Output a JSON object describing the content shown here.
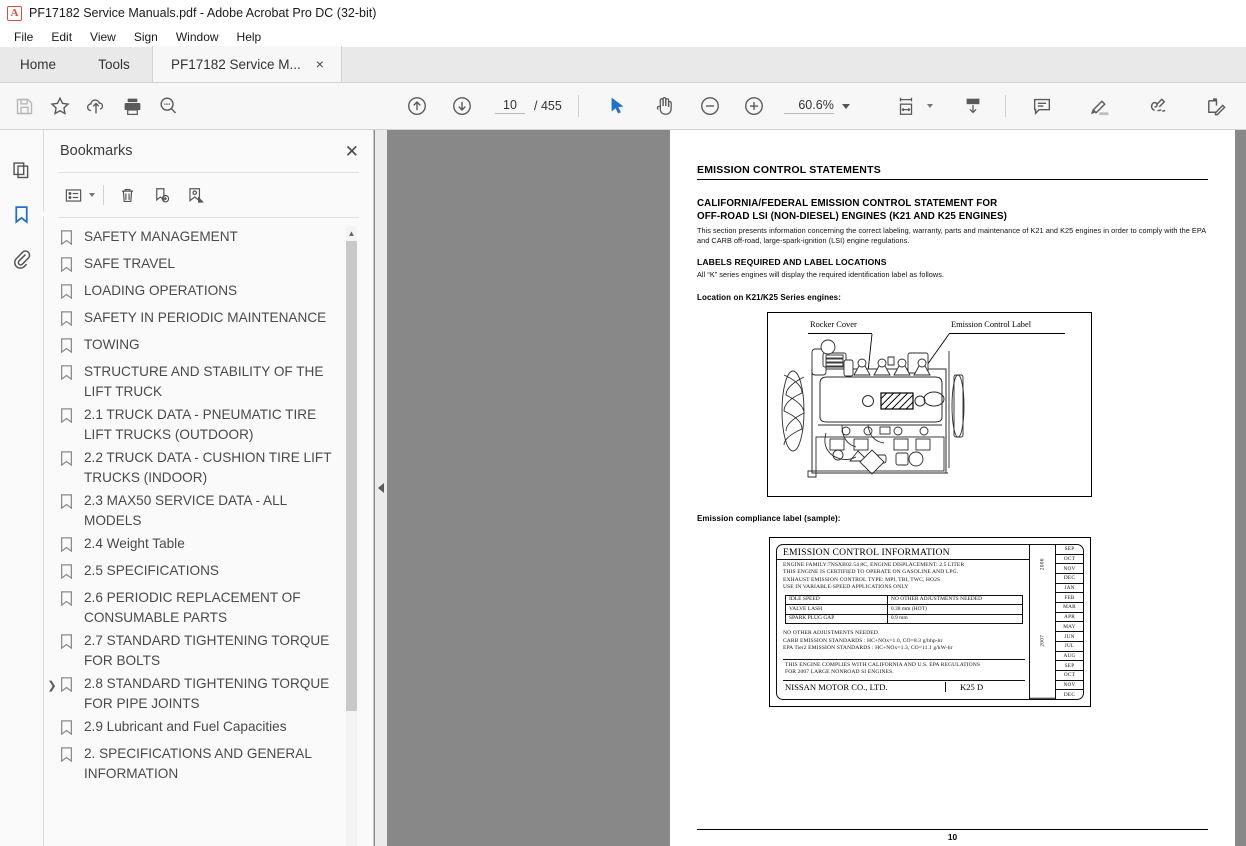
{
  "window": {
    "title": "PF17182 Service Manuals.pdf - Adobe Acrobat Pro DC (32-bit)",
    "app_icon": "acrobat-icon",
    "icon_glyph": "A"
  },
  "menubar": {
    "items": [
      "File",
      "Edit",
      "View",
      "Sign",
      "Window",
      "Help"
    ]
  },
  "tabs": [
    {
      "label": "Home",
      "name": "tab-home",
      "active": false
    },
    {
      "label": "Tools",
      "name": "tab-tools",
      "active": false
    },
    {
      "label": "PF17182 Service M...",
      "name": "tab-document",
      "active": true,
      "close": "×"
    }
  ],
  "toolbar": {
    "save_label": "save-icon",
    "star_label": "add-to-favorites-icon",
    "cloud_label": "upload-to-cloud-icon",
    "print_label": "print-icon",
    "search_label": "find-text-icon",
    "prev_label": "previous-page-icon",
    "next_label": "next-page-icon",
    "page_current": "10",
    "page_total": "/ 455",
    "select_label": "select-tool-icon",
    "hand_label": "hand-tool-icon",
    "zoom_out_label": "zoom-out-icon",
    "zoom_in_label": "zoom-in-icon",
    "zoom_value": "60.6%",
    "fit_label": "fit-page-width-icon",
    "scroll_label": "scroll-mode-icon",
    "comment_label": "add-comment-icon",
    "highlight_label": "highlight-text-icon",
    "sign_label": "fill-and-sign-icon",
    "stamp_label": "request-signatures-icon"
  },
  "rail": [
    {
      "name": "sidebar-page-thumbnails",
      "icon": "pages-icon",
      "active": false
    },
    {
      "name": "sidebar-bookmarks",
      "icon": "bookmark-icon",
      "active": true
    },
    {
      "name": "sidebar-attachments",
      "icon": "paperclip-icon",
      "active": false
    }
  ],
  "panel": {
    "title": "Bookmarks",
    "close": "✕",
    "tools": [
      {
        "name": "bookmark-options-menu",
        "icon": "list-options-icon"
      },
      {
        "name": "delete-bookmark-button",
        "icon": "trash-icon"
      },
      {
        "name": "new-bookmark-button",
        "icon": "new-bookmark-icon"
      },
      {
        "name": "find-bookmark-button",
        "icon": "bookmark-target-icon"
      }
    ],
    "bookmarks": [
      {
        "label": "SAFETY MANAGEMENT",
        "expandable": false
      },
      {
        "label": "SAFE TRAVEL",
        "expandable": false
      },
      {
        "label": "LOADING OPERATIONS",
        "expandable": false
      },
      {
        "label": "SAFETY IN PERIODIC MAINTENANCE",
        "expandable": false
      },
      {
        "label": "TOWING",
        "expandable": false
      },
      {
        "label": "STRUCTURE AND STABILITY OF THE LIFT TRUCK",
        "expandable": false
      },
      {
        "label": "2.1 TRUCK DATA - PNEUMATIC TIRE LIFT TRUCKS (OUTDOOR)",
        "expandable": false
      },
      {
        "label": "2.2 TRUCK DATA - CUSHION TIRE LIFT TRUCKS (INDOOR)",
        "expandable": false
      },
      {
        "label": "2.3 MAX50 SERVICE DATA - ALL MODELS",
        "expandable": false
      },
      {
        "label": "2.4 Weight Table",
        "expandable": false
      },
      {
        "label": "2.5 SPECIFICATIONS",
        "expandable": false
      },
      {
        "label": "2.6 PERIODIC REPLACEMENT OF CONSUMABLE PARTS",
        "expandable": false
      },
      {
        "label": "2.7 STANDARD TIGHTENING TORQUE FOR BOLTS",
        "expandable": false
      },
      {
        "label": "2.8 STANDARD TIGHTENING TORQUE FOR PIPE JOINTS",
        "expandable": true
      },
      {
        "label": "2.9 Lubricant and Fuel Capacities",
        "expandable": false
      },
      {
        "label": "2. SPECIFICATIONS AND GENERAL INFORMATION",
        "expandable": false
      }
    ]
  },
  "document": {
    "h1": "EMISSION CONTROL STATEMENTS",
    "h2_line1": "CALIFORNIA/FEDERAL EMISSION CONTROL STATEMENT FOR",
    "h2_line2": "OFF-ROAD LSI (NON-DIESEL) ENGINES (K21 AND K25 ENGINES)",
    "paragraph": "This section presents information concerning the correct labeling, warranty, parts and maintenance of K21 and K25 engines in order to comply with the EPA and CARB off-road, large-spark-ignition (LSI) engine regulations.",
    "h3": "LABELS REQUIRED AND LABEL LOCATIONS",
    "paragraph2": "All “K” series engines will display the required identification label as follows.",
    "h4": "Location on K21/K25 Series engines:",
    "figure": {
      "caption_left": "Rocker Cover",
      "caption_right": "Emission Control Label"
    },
    "label_caption": "Emission compliance label (sample):",
    "label": {
      "title": "EMISSION CONTROL INFORMATION",
      "lines": [
        "ENGINE FAMILY:7NSXB02.54 8C,  ENGINE DISPLACEMENT: 2.5 LITER",
        "THIS ENGINE IS CERTIFIED TO OPERATE ON GASOLINE AND LPG.",
        "EXHAUST EMISSION CONTROL TYPE: MPI, TBI, TWC, HO2S",
        "USE IN VARIABLE-SPEED APPLICATIONS ONLY"
      ],
      "spec_rows": [
        {
          "key": "IDLE SPEED",
          "value": "NO OTHER ADJUSTMENTS NEEDED"
        },
        {
          "key": "VALVE LASH",
          "value": "0.38 mm (HOT)"
        },
        {
          "key": "SPARK PLUG GAP",
          "value": "0.9 mm"
        }
      ],
      "mid_lines": [
        "NO OTHER ADJUSTMENTS NEEDED.",
        "CARB EMISSION STANDARDS : HC+NOx=1.0, CO=8.3 g/bhp-hr",
        "EPA Tier2 EMISSION STANDARDS : HC+NOx=1.3, CO=11.1 g/kW-hr"
      ],
      "note_lines": [
        "THIS ENGINE COMPLIES WITH CALIFORNIA AND U.S. EPA REGULATIONS",
        "FOR 2007 LARGE NONROAD SI ENGINES."
      ],
      "maker": "NISSAN MOTOR CO., LTD.",
      "model": "K25 D",
      "years": [
        "2006",
        "2007"
      ],
      "months": [
        "SEP",
        "OCT",
        "NOV",
        "DEC",
        "JAN",
        "FEB",
        "MAR",
        "APR",
        "MAY",
        "JUN",
        "JUL",
        "AUG",
        "SEP",
        "OCT",
        "NOV",
        "DEC"
      ]
    },
    "page_number": "10"
  },
  "colors": {
    "accent": "#1e72c8",
    "toolbar_bg": "#f7f7f7",
    "viewport_bg": "#888888",
    "panel_bg": "#fafafa"
  }
}
